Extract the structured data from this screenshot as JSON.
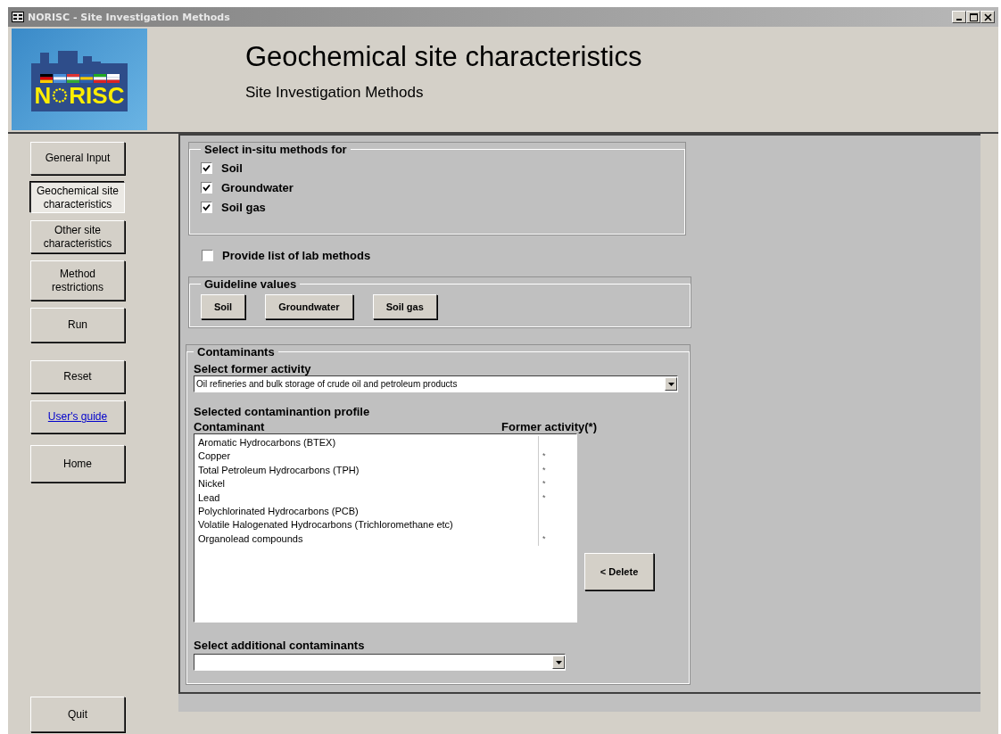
{
  "window": {
    "title": "NORISC - Site Investigation Methods"
  },
  "logo": {
    "text_before": "N",
    "text_after": "RISC"
  },
  "header": {
    "title": "Geochemical site characteristics",
    "subtitle": "Site Investigation Methods"
  },
  "sidebar": {
    "items": [
      {
        "label": "General Input",
        "kind": "button",
        "selected": false
      },
      {
        "label": "Geochemical site characteristics",
        "kind": "button",
        "selected": true
      },
      {
        "label": "Other site characteristics",
        "kind": "button",
        "selected": false
      },
      {
        "label": "Method restrictions",
        "kind": "button",
        "selected": false
      },
      {
        "label": "Run",
        "kind": "button",
        "selected": false
      },
      {
        "label": "Reset",
        "kind": "button",
        "selected": false
      },
      {
        "label": "User's guide",
        "kind": "link",
        "selected": false
      },
      {
        "label": "Home",
        "kind": "button",
        "selected": false
      }
    ],
    "quit": "Quit"
  },
  "in_situ": {
    "title": "Select in-situ methods for",
    "options": [
      {
        "label": "Soil",
        "checked": true
      },
      {
        "label": "Groundwater",
        "checked": true
      },
      {
        "label": "Soil gas",
        "checked": true
      }
    ]
  },
  "lab_methods": {
    "label": "Provide list of lab methods",
    "checked": false
  },
  "guideline": {
    "title": "Guideline values",
    "buttons": [
      "Soil",
      "Groundwater",
      "Soil gas"
    ]
  },
  "contaminants": {
    "title": "Contaminants",
    "activity_label": "Select former activity",
    "activity_value": "Oil refineries and bulk storage of crude oil and petroleum products",
    "profile_label": "Selected contaminantion profile",
    "columns": [
      "Contaminant",
      "Former activity(*)"
    ],
    "rows": [
      {
        "name": "Aromatic Hydrocarbons (BTEX)"
      },
      {
        "name": "Copper",
        "mark": "*"
      },
      {
        "name": "Total Petroleum Hydrocarbons (TPH)",
        "mark": "*"
      },
      {
        "name": "Nickel",
        "mark": "*"
      },
      {
        "name": "Lead",
        "mark": "*"
      },
      {
        "name": "Polychlorinated Hydrocarbons (PCB)"
      },
      {
        "name": "Volatile Halogenated Hydrocarbons (Trichloromethane etc)"
      },
      {
        "name": "Organolead compounds",
        "mark": "*"
      }
    ],
    "delete_button": "< Delete",
    "additional_label": "Select additional contaminants"
  }
}
